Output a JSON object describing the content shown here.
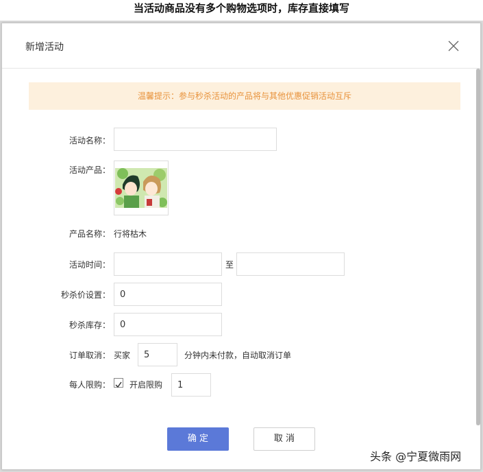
{
  "caption": "当活动商品没有多个购物选项时，库存直接填写",
  "modal": {
    "title": "新增活动",
    "notice": "温馨提示：参与秒杀活动的产品将与其他优惠促销活动互斥"
  },
  "form": {
    "name_label": "活动名称：",
    "name_value": "",
    "product_label": "活动产品：",
    "product_name_label": "产品名称：",
    "product_name_value": "行将枯木",
    "time_label": "活动时间：",
    "time_start": "",
    "time_to": "至",
    "time_end": "",
    "price_label": "秒杀价设置：",
    "price_value": "0",
    "stock_label": "秒杀库存：",
    "stock_value": "0",
    "cancel_label": "订单取消：",
    "cancel_prefix": "买家",
    "cancel_minutes": "5",
    "cancel_suffix": "分钟内未付款，自动取消订单",
    "limit_label": "每人限购：",
    "limit_checkbox_label": "开启限购",
    "limit_checked": true,
    "limit_value": "1"
  },
  "buttons": {
    "confirm": "确 定",
    "cancel": "取 消"
  },
  "watermark": "头条 @宁夏微雨网",
  "colors": {
    "primary": "#5b79d8",
    "notice_bg": "#fdf0dd",
    "notice_text": "#e8923b"
  }
}
